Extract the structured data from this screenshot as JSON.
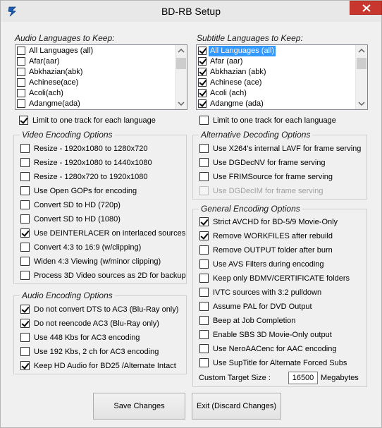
{
  "window": {
    "title": "BD-RB Setup"
  },
  "audio_languages": {
    "title": "Audio Languages to Keep:",
    "items": [
      {
        "label": "All Languages (all)",
        "checked": false
      },
      {
        "label": "Afar(aar)",
        "checked": false
      },
      {
        "label": "Abkhazian(abk)",
        "checked": false
      },
      {
        "label": "Achinese(ace)",
        "checked": false
      },
      {
        "label": "Acoli(ach)",
        "checked": false
      },
      {
        "label": "Adangme(ada)",
        "checked": false
      }
    ],
    "limit_label": "Limit to one track for each language",
    "limit_checked": true
  },
  "subtitle_languages": {
    "title": "Subtitle Languages to Keep:",
    "items": [
      {
        "label": "All Languages (all)",
        "checked": true,
        "selected": true
      },
      {
        "label": "Afar (aar)",
        "checked": true
      },
      {
        "label": "Abkhazian (abk)",
        "checked": true
      },
      {
        "label": "Achinese (ace)",
        "checked": true
      },
      {
        "label": "Acoli (ach)",
        "checked": true
      },
      {
        "label": "Adangme (ada)",
        "checked": true
      }
    ],
    "limit_label": "Limit to one track for each language",
    "limit_checked": false
  },
  "video_options": {
    "title": "Video Encoding Options",
    "items": [
      {
        "label": "Resize  - 1920x1080 to 1280x720",
        "checked": false
      },
      {
        "label": "Resize  - 1920x1080 to 1440x1080",
        "checked": false
      },
      {
        "label": "Resize  - 1280x720 to 1920x1080",
        "checked": false
      },
      {
        "label": "Use Open GOPs for encoding",
        "checked": false
      },
      {
        "label": "Convert SD to HD (720p)",
        "checked": false
      },
      {
        "label": "Convert SD to HD (1080)",
        "checked": false
      },
      {
        "label": "Use DEINTERLACER on interlaced sources",
        "checked": true
      },
      {
        "label": "Convert 4:3 to 16:9 (w/clipping)",
        "checked": false
      },
      {
        "label": "Widen 4:3 Viewing (w/minor clipping)",
        "checked": false
      },
      {
        "label": "Process 3D Video sources as 2D for backup",
        "checked": false
      }
    ]
  },
  "audio_options": {
    "title": "Audio Encoding Options",
    "items": [
      {
        "label": "Do not convert DTS to AC3  (Blu-Ray only)",
        "checked": true
      },
      {
        "label": "Do not reencode AC3  (Blu-Ray only)",
        "checked": true
      },
      {
        "label": "Use 448 Kbs for AC3 encoding",
        "checked": false
      },
      {
        "label": "Use 192 Kbs, 2 ch for AC3 encoding",
        "checked": false
      },
      {
        "label": "Keep HD Audio for BD25 /Alternate Intact",
        "checked": true
      }
    ]
  },
  "alt_decoding": {
    "title": "Alternative Decoding Options",
    "items": [
      {
        "label": "Use X264's internal LAVF for frame serving",
        "checked": false,
        "disabled": false
      },
      {
        "label": "Use DGDecNV for frame serving",
        "checked": false,
        "disabled": false
      },
      {
        "label": "Use FRIMSource for frame serving",
        "checked": false,
        "disabled": false
      },
      {
        "label": "Use DGDecIM for frame serving",
        "checked": false,
        "disabled": true
      }
    ]
  },
  "general_options": {
    "title": "General Encoding Options",
    "items": [
      {
        "label": "Strict AVCHD for BD-5/9 Movie-Only",
        "checked": true
      },
      {
        "label": "Remove WORKFILES after rebuild",
        "checked": true
      },
      {
        "label": "Remove OUTPUT folder after burn",
        "checked": false
      },
      {
        "label": "Use AVS Filters during encoding",
        "checked": false
      },
      {
        "label": "Keep only BDMV/CERTIFICATE folders",
        "checked": false
      },
      {
        "label": "IVTC sources with 3:2 pulldown",
        "checked": false
      },
      {
        "label": "Assume PAL for DVD Output",
        "checked": false
      },
      {
        "label": "Beep at Job Completion",
        "checked": false
      },
      {
        "label": "Enable SBS 3D Movie-Only output",
        "checked": false
      },
      {
        "label": "Use NeroAACenc for AAC encoding",
        "checked": false
      },
      {
        "label": "Use SupTitle for Alternate Forced Subs",
        "checked": false
      }
    ],
    "target_size_label": "Custom Target Size :",
    "target_size_value": "16500",
    "target_size_unit": "Megabytes"
  },
  "buttons": {
    "save": "Save Changes",
    "exit": "Exit (Discard Changes)"
  }
}
